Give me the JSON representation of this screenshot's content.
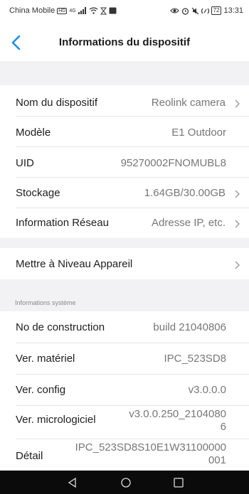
{
  "status_bar": {
    "carrier": "China Mobile",
    "hd_badge": "HD",
    "signal": "4G",
    "battery": "72",
    "time": "13:31"
  },
  "header": {
    "title": "Informations du dispositif"
  },
  "device": {
    "rows": [
      {
        "label": "Nom du dispositif",
        "value": "Reolink camera"
      },
      {
        "label": "Modèle",
        "value": "E1 Outdoor"
      },
      {
        "label": "UID",
        "value": "95270002FNOMUBL8"
      },
      {
        "label": "Stockage",
        "value": "1.64GB/30.00GB"
      },
      {
        "label": "Information Réseau",
        "value": "Adresse IP, etc."
      }
    ]
  },
  "upgrade": {
    "label": "Mettre à Niveau Appareil"
  },
  "system": {
    "section_title": "Informations système",
    "rows": [
      {
        "label": "No de construction",
        "value": "build 21040806"
      },
      {
        "label": "Ver. matériel",
        "value": "IPC_523SD8"
      },
      {
        "label": "Ver. config",
        "value": "v3.0.0.0"
      },
      {
        "label": "Ver. micrologiciel",
        "value_line1": "v3.0.0.250_2104080",
        "value_line2": "6"
      },
      {
        "label": "Détail",
        "value_line1": "IPC_523SD8S10E1W31100000",
        "value_line2": "001"
      }
    ]
  },
  "colors": {
    "accent": "#1a8fe3",
    "background": "#f2f2f4",
    "nav_bar": "#0b0b0b"
  }
}
